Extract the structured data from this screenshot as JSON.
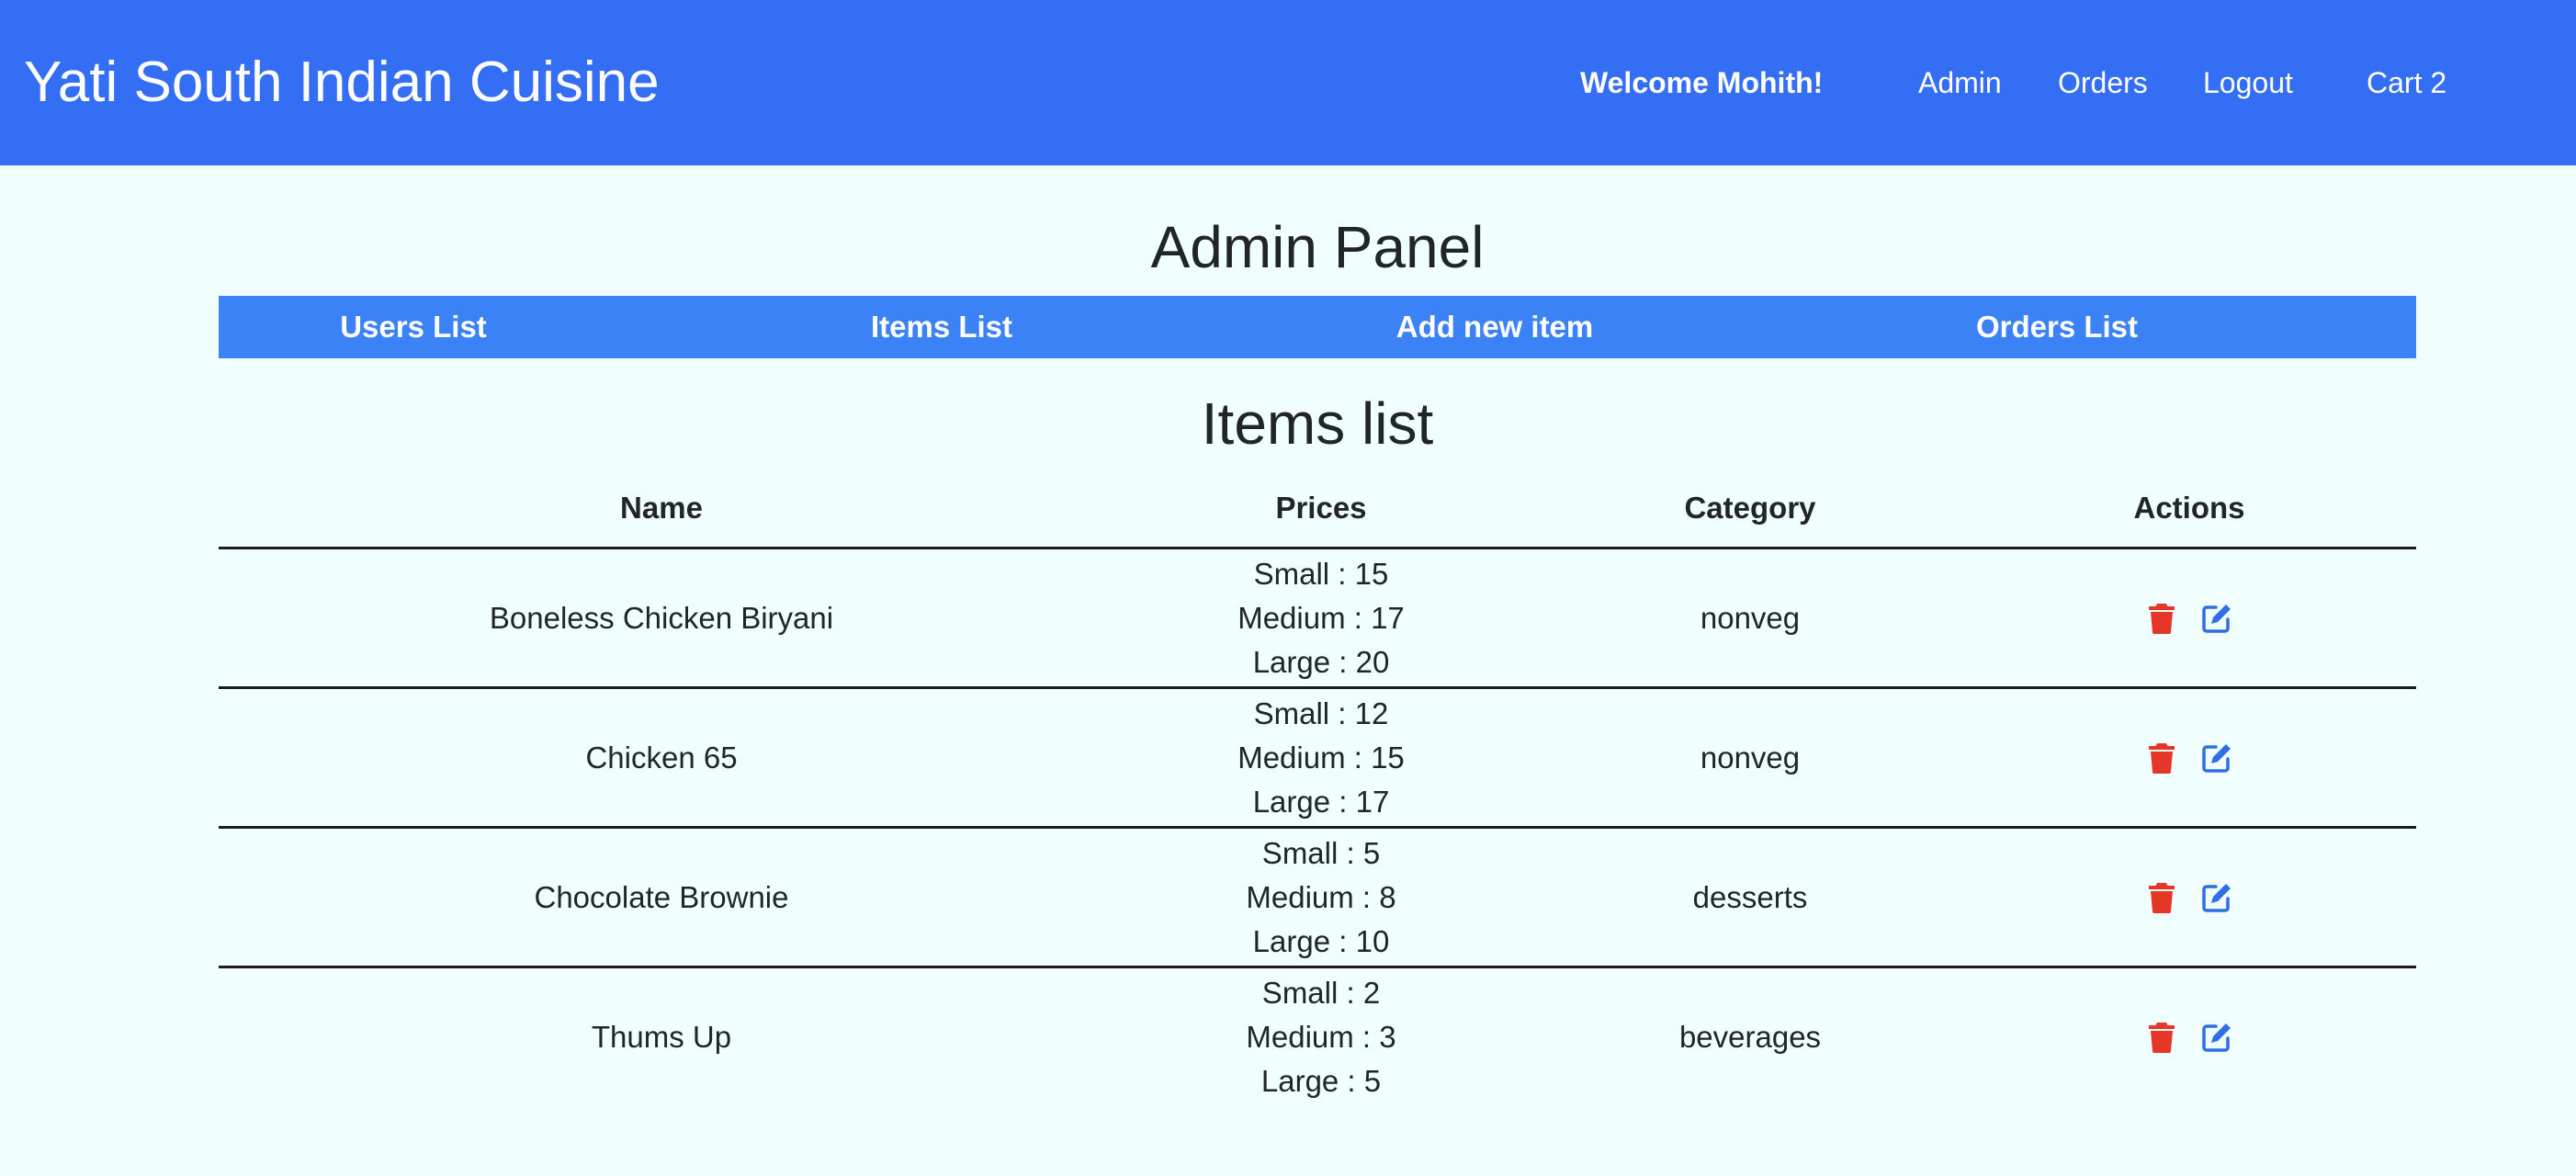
{
  "header": {
    "brand": "Yati South Indian Cuisine",
    "welcome": "Welcome Mohith!",
    "nav": [
      "Admin",
      "Orders",
      "Logout",
      "Cart 2"
    ]
  },
  "admin": {
    "title": "Admin Panel",
    "tabs": [
      "Users List",
      "Items List",
      "Add new item",
      "Orders List"
    ]
  },
  "items": {
    "title": "Items list",
    "columns": [
      "Name",
      "Prices",
      "Category",
      "Actions"
    ],
    "rows": [
      {
        "name": "Boneless Chicken Biryani",
        "prices": [
          "Small : 15",
          "Medium : 17",
          "Large : 20"
        ],
        "category": "nonveg"
      },
      {
        "name": "Chicken 65",
        "prices": [
          "Small : 12",
          "Medium : 15",
          "Large : 17"
        ],
        "category": "nonveg"
      },
      {
        "name": "Chocolate Brownie",
        "prices": [
          "Small : 5",
          "Medium : 8",
          "Large : 10"
        ],
        "category": "desserts"
      },
      {
        "name": "Thums Up",
        "prices": [
          "Small : 2",
          "Medium : 3",
          "Large : 5"
        ],
        "category": "beverages"
      }
    ]
  },
  "icons": {
    "delete": "trash-icon",
    "edit": "edit-icon"
  },
  "colors": {
    "navbar": "#336ef5",
    "tabbar": "#3b82f6",
    "background": "#f0fffe",
    "delete": "#e53627",
    "edit": "#2f6fe4"
  }
}
